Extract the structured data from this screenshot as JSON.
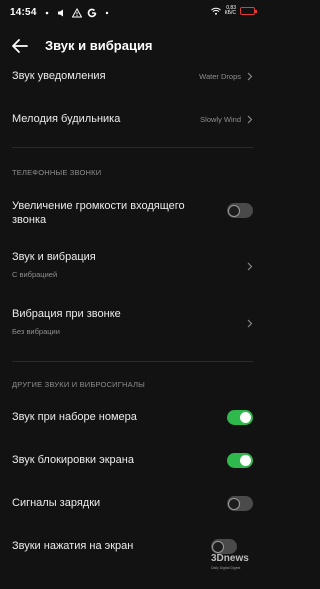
{
  "status_bar": {
    "time": "14:54",
    "speed_value": "0,83",
    "speed_unit": "КБ/С"
  },
  "header": {
    "title": "Звук и вибрация"
  },
  "rows": {
    "notification_sound": {
      "title": "Звук уведомления",
      "value": "Water Drops"
    },
    "alarm_melody": {
      "title": "Мелодия будильника",
      "value": "Slowly Wind"
    },
    "section_calls": "ТЕЛЕФОННЫЕ ЗВОНКИ",
    "increase_volume": {
      "title_line1": "Увеличение громкости входящего",
      "title_line2": "звонка",
      "enabled": false
    },
    "sound_vibration": {
      "title": "Звук и вибрация",
      "subtitle": "С вибрацией"
    },
    "ring_vibration": {
      "title": "Вибрация при звонке",
      "subtitle": "Без вибрации"
    },
    "section_other": "ДРУГИЕ ЗВУКИ И ВИБРОСИГНАЛЫ",
    "dial_sound": {
      "title": "Звук при наборе номера",
      "enabled": true
    },
    "lock_sound": {
      "title": "Звук блокировки экрана",
      "enabled": true
    },
    "charge_signals": {
      "title": "Сигналы зарядки",
      "enabled": false
    },
    "touch_sounds": {
      "title": "Звуки нажатия на экран",
      "enabled": false
    }
  },
  "watermark": {
    "text": "3Dnews",
    "sub": "Daily Digital Digest"
  },
  "colors": {
    "toggle_on": "#2FB84B",
    "background": "#121212",
    "battery": "#E23A3A"
  }
}
